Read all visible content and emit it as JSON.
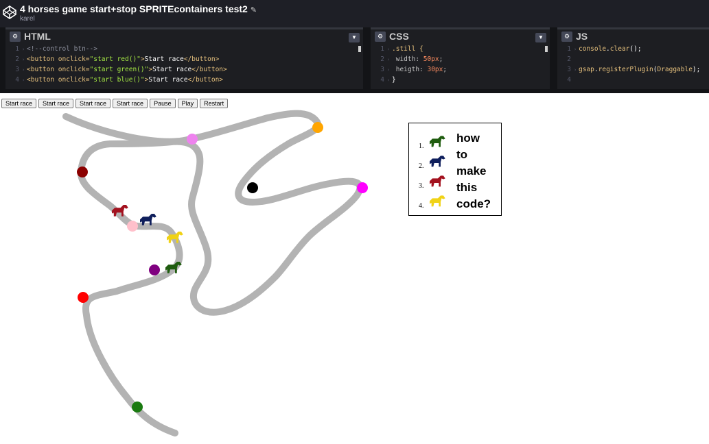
{
  "header": {
    "title": "4 horses game start+stop SPRITEcontainers test2",
    "author": "karel",
    "edit_icon": "pencil-icon"
  },
  "panels": {
    "html": {
      "title": "HTML",
      "lines": [
        {
          "n": "1",
          "parts": [
            {
              "c": "c-comment",
              "t": "<!--control btn-->"
            }
          ]
        },
        {
          "n": "2",
          "parts": [
            {
              "c": "c-tag",
              "t": "<button "
            },
            {
              "c": "c-attr",
              "t": "onclick="
            },
            {
              "c": "c-str",
              "t": "\"start red()\""
            },
            {
              "c": "c-tag",
              "t": ">"
            },
            {
              "c": "c-text",
              "t": "Start race"
            },
            {
              "c": "c-tag",
              "t": "</button>"
            }
          ]
        },
        {
          "n": "3",
          "parts": [
            {
              "c": "c-tag",
              "t": "<button "
            },
            {
              "c": "c-attr",
              "t": "onclick="
            },
            {
              "c": "c-str",
              "t": "\"start green()\""
            },
            {
              "c": "c-tag",
              "t": ">"
            },
            {
              "c": "c-text",
              "t": "Start race"
            },
            {
              "c": "c-tag",
              "t": "</button>"
            }
          ]
        },
        {
          "n": "4",
          "parts": [
            {
              "c": "c-tag",
              "t": "<button "
            },
            {
              "c": "c-attr",
              "t": "onclick="
            },
            {
              "c": "c-str",
              "t": "\"start blue()\""
            },
            {
              "c": "c-tag",
              "t": ">"
            },
            {
              "c": "c-text",
              "t": "Start race"
            },
            {
              "c": "c-tag",
              "t": "</button>"
            }
          ]
        }
      ]
    },
    "css": {
      "title": "CSS",
      "lines": [
        {
          "n": "1",
          "parts": [
            {
              "c": "c-sel",
              "t": ".still {"
            }
          ]
        },
        {
          "n": "2",
          "parts": [
            {
              "c": "c-prop",
              "t": "  width: "
            },
            {
              "c": "c-num",
              "t": "50px"
            },
            {
              "c": "c-prop",
              "t": ";"
            }
          ]
        },
        {
          "n": "3",
          "parts": [
            {
              "c": "c-prop",
              "t": "  heigth: "
            },
            {
              "c": "c-num",
              "t": "30px"
            },
            {
              "c": "c-prop",
              "t": ";"
            }
          ]
        },
        {
          "n": "4",
          "parts": [
            {
              "c": "c-white",
              "t": "}"
            }
          ]
        }
      ]
    },
    "js": {
      "title": "JS",
      "lines": [
        {
          "n": "1",
          "parts": [
            {
              "c": "c-js",
              "t": "console"
            },
            {
              "c": "c-white",
              "t": "."
            },
            {
              "c": "c-js",
              "t": "clear"
            },
            {
              "c": "c-white",
              "t": "();"
            }
          ]
        },
        {
          "n": "2",
          "parts": []
        },
        {
          "n": "3",
          "parts": [
            {
              "c": "c-js",
              "t": "gsap"
            },
            {
              "c": "c-white",
              "t": "."
            },
            {
              "c": "c-js",
              "t": "registerPlugin"
            },
            {
              "c": "c-white",
              "t": "("
            },
            {
              "c": "c-js",
              "t": "Draggable"
            },
            {
              "c": "c-white",
              "t": ");"
            }
          ]
        },
        {
          "n": "4",
          "parts": []
        }
      ]
    }
  },
  "controls": {
    "start1": "Start race",
    "start2": "Start race",
    "start3": "Start race",
    "start4": "Start race",
    "pause": "Pause",
    "play": "Play",
    "restart": "Restart"
  },
  "question": {
    "numbers": [
      "1.",
      "2.",
      "3.",
      "4."
    ],
    "horse_colors": [
      "#1f5c0f",
      "#0f1f5c",
      "#a3121f",
      "#f0d216"
    ],
    "text_lines": [
      "how",
      "to",
      "make",
      "this",
      "code?"
    ]
  },
  "colors": {
    "track": "#b3b3b3",
    "marker_orange": "#ffa500",
    "marker_violet": "#ee82ee",
    "marker_darkred": "#8b0000",
    "marker_black": "#000000",
    "marker_magenta": "#ff00ff",
    "marker_pink": "#ffc0cb",
    "marker_purple": "#800080",
    "marker_red": "#ff0000",
    "marker_green": "#1a7a10",
    "horse_red": "#a3121f",
    "horse_blue": "#0f1f5c",
    "horse_yellow": "#f0d216",
    "horse_green": "#1f5c0f"
  }
}
